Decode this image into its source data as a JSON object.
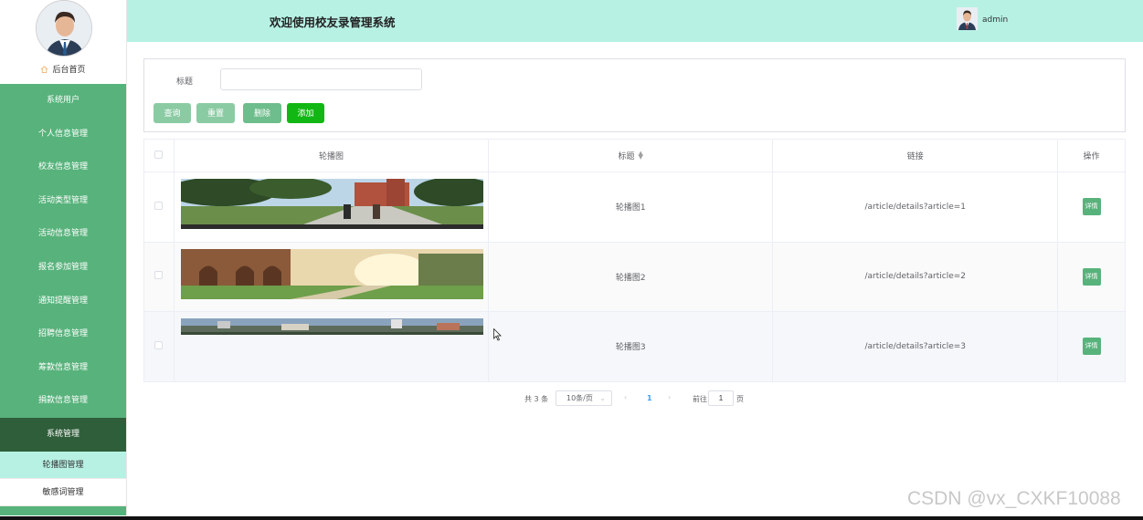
{
  "header": {
    "title": "欢迎使用校友录管理系统",
    "username": "admin"
  },
  "sidebar": {
    "home_label": "后台首页",
    "menu_items": [
      {
        "label": "系统用户"
      },
      {
        "label": "个人信息管理"
      },
      {
        "label": "校友信息管理"
      },
      {
        "label": "活动类型管理"
      },
      {
        "label": "活动信息管理"
      },
      {
        "label": "报名参加管理"
      },
      {
        "label": "通知提醒管理"
      },
      {
        "label": "招聘信息管理"
      },
      {
        "label": "筹款信息管理"
      },
      {
        "label": "捐款信息管理"
      }
    ],
    "group_label": "系统管理",
    "submenu_items": [
      {
        "label": "轮播图管理",
        "active": true
      },
      {
        "label": "敏感词管理",
        "active": false
      }
    ]
  },
  "search": {
    "label": "标题",
    "value": "",
    "placeholder": ""
  },
  "buttons": {
    "query": "查询",
    "reset": "重置",
    "delete": "删除",
    "add": "添加"
  },
  "table": {
    "columns": {
      "image": "轮播图",
      "title": "标题",
      "link": "链接",
      "actions": "操作"
    },
    "rows": [
      {
        "title": "轮播图1",
        "link": "/article/details?article=1",
        "action": "详情"
      },
      {
        "title": "轮播图2",
        "link": "/article/details?article=2",
        "action": "详情"
      },
      {
        "title": "轮播图3",
        "link": "/article/details?article=3",
        "action": "详情"
      }
    ]
  },
  "pagination": {
    "total_text": "共 3 条",
    "page_size": "10条/页",
    "current_page": "1",
    "goto_label": "前往",
    "goto_value": "1",
    "page_unit": "页"
  },
  "watermark": "CSDN @vx_CXKF10088",
  "colors": {
    "sidebar": "#57b37b",
    "header": "#b7f1e4",
    "group": "#2f5e3a",
    "add_button": "#13b713",
    "active_submenu": "#b7f1e4"
  }
}
